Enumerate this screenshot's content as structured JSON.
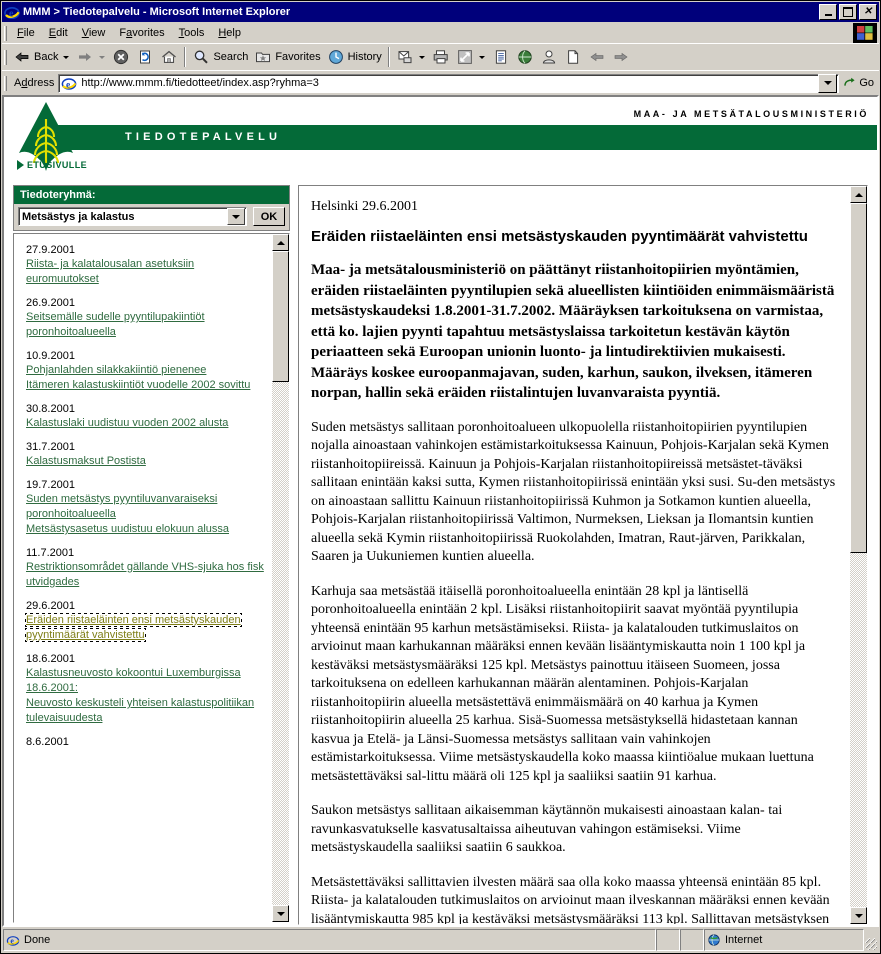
{
  "window": {
    "title": "MMM > Tiedotepalvelu - Microsoft Internet Explorer",
    "minimize_label": "Minimize",
    "maximize_label": "Maximize",
    "close_label": "Close"
  },
  "menubar": {
    "items": [
      {
        "label": "File",
        "accel": "F"
      },
      {
        "label": "Edit",
        "accel": "E"
      },
      {
        "label": "View",
        "accel": "V"
      },
      {
        "label": "Favorites",
        "accel": "a"
      },
      {
        "label": "Tools",
        "accel": "T"
      },
      {
        "label": "Help",
        "accel": "H"
      }
    ]
  },
  "toolbar": {
    "back": "Back",
    "forward": "",
    "stop": "",
    "refresh": "",
    "home": "",
    "search": "Search",
    "favorites": "Favorites",
    "history": "History",
    "mail": "",
    "print": "",
    "edit": "",
    "discuss": "",
    "messenger": "",
    "realcom": "",
    "blank": ""
  },
  "address": {
    "label": "Address",
    "value": "http://www.mmm.fi/tiedotteet/index.asp?ryhma=3",
    "go_label": "Go"
  },
  "banner": {
    "service_title": "TIEDOTEPALVELU",
    "ministry": "MAA- JA METSÄTALOUSMINISTERIÖ",
    "home_link": "ETUSIVULLE",
    "brand_green": "#046a38",
    "brand_yellow": "#e3e000"
  },
  "sidebar": {
    "group_header": "Tiedoteryhmä:",
    "select_value": "Metsästys ja kalastus",
    "ok_label": "OK",
    "news": [
      {
        "date": "27.9.2001",
        "links": [
          "Riista- ja kalatalousalan asetuksiin euromuutokset"
        ],
        "active": false
      },
      {
        "date": "26.9.2001",
        "links": [
          "Seitsemälle sudelle pyyntilupakiintiöt poronhoitoalueella"
        ],
        "active": false
      },
      {
        "date": "10.9.2001",
        "links": [
          "Pohjanlahden silakkakiintiö pienenee",
          "Itämeren kalastuskiintiöt vuodelle 2002 sovittu"
        ],
        "active": false
      },
      {
        "date": "30.8.2001",
        "links": [
          "Kalastuslaki uudistuu vuoden 2002 alusta"
        ],
        "active": false
      },
      {
        "date": "31.7.2001",
        "links": [
          "Kalastusmaksut Postista"
        ],
        "active": false
      },
      {
        "date": "19.7.2001",
        "links": [
          "Suden metsästys pyyntiluvanvaraiseksi poronhoitoalueella",
          "Metsästysasetus uudistuu elokuun alussa"
        ],
        "active": false
      },
      {
        "date": "11.7.2001",
        "links": [
          "Restriktionsområdet gällande VHS-sjuka hos fisk utvidgades"
        ],
        "active": false
      },
      {
        "date": "29.6.2001",
        "links": [
          "Eräiden riistaeläinten ensi metsästyskauden pyyntimäärät vahvistettu"
        ],
        "active": true
      },
      {
        "date": "18.6.2001",
        "links": [
          "Kalastusneuvosto kokoontui Luxemburgissa 18.6.2001:",
          "Neuvosto keskusteli yhteisen kalastuspolitiikan tulevaisuudesta"
        ],
        "active": false
      },
      {
        "date": "8.6.2001",
        "links": [],
        "active": false
      }
    ]
  },
  "article": {
    "place_date": "Helsinki 29.6.2001",
    "title": "Eräiden riistaeläinten ensi metsästyskauden pyyntimäärät vahvistettu",
    "lead": "Maa- ja metsätalousministeriö on päättänyt riistanhoitopiirien myöntämien, eräiden riistaeläinten pyyntilupien sekä alueellisten kiintiöiden enimmäismääristä metsästyskaudeksi 1.8.2001-31.7.2002. Määräyksen tarkoituksena on varmistaa, että ko. lajien pyynti tapahtuu metsästyslaissa tarkoitetun kestävän käytön periaatteen sekä Euroopan unionin luonto- ja lintudirektiivien mukaisesti. Määräys koskee euroopanmajavan, suden, karhun, saukon, ilveksen, itämeren norpan, hallin sekä eräiden riistalintujen luvanvaraista pyyntiä.",
    "paragraphs": [
      "Suden metsästys sallitaan poronhoitoalueen ulkopuolella riistanhoitopiirien pyyntilupien nojalla ainoastaan vahinkojen estämistarkoituksessa Kainuun, Pohjois-Karjalan sekä Kymen riistanhoitopiireissä. Kainuun ja Pohjois-Karjalan riistanhoitopiireissä metsästet-täväksi sallitaan enintään kaksi sutta, Kymen riistanhoitopiirissä enintään yksi susi. Su-den metsästys on ainoastaan sallittu Kainuun riistanhoitopiirissä Kuhmon ja Sotkamon kuntien alueella, Pohjois-Karjalan riistanhoitopiirissä Valtimon, Nurmeksen, Lieksan ja Ilomantsin kuntien alueella sekä Kymin riistanhoitopiirissä Ruokolahden, Imatran, Raut-järven, Parikkalan, Saaren ja Uukuniemen kuntien alueella.",
      "Karhuja saa metsästää itäisellä poronhoitoalueella enintään 28 kpl ja läntisellä poronhoitoalueella enintään 2 kpl. Lisäksi riistanhoitopiirit saavat myöntää pyyntilupia yhteensä enintään 95 karhun metsästämiseksi. Riista- ja kalatalouden tutkimuslaitos on arvioinut maan karhukannan määräksi ennen kevään lisääntymiskautta noin 1 100 kpl ja kestäväksi metsästysmääräksi 125 kpl. Metsästys painottuu itäiseen Suomeen, jossa tarkoituksena on edelleen karhukannan määrän alentaminen. Pohjois-Karjalan riistanhoitopiirin alueella metsästettävä enimmäismäärä on 40 karhua ja Kymen riistanhoitopiirin alueella 25 karhua. Sisä-Suomessa metsästyksellä hidastetaan kannan kasvua ja Etelä- ja Länsi-Suomessa metsästys sallitaan vain vahinkojen estämistarkoituksessa. Viime metsästyskaudella koko maassa kiintiöalue mukaan luettuna metsästettäväksi sal-littu määrä oli 125 kpl ja saaliiksi saatiin 91 karhua.",
      "Saukon metsästys sallitaan aikaisemman käytännön mukaisesti ainoastaan kalan- tai ravunkasvatukselle kasvatusaltaissa aiheutuvan vahingon estämiseksi. Viime metsästyskaudella saaliiksi saatiin 6 saukkoa.",
      "Metsästettäväksi sallittavien ilvesten määrä saa olla koko maassa yhteensä enintään 85 kpl. Riista- ja kalatalouden tutkimuslaitos on arvioinut maan ilveskannan määräksi ennen kevään lisääntymiskautta 985 kpl ja kestäväksi metsästysmääräksi 113 kpl. Sallittavan metsästyksen tarkoituksena on rajoittaa kannan kasvua Kymen, Pohjois-Karjalan, Pohjois-Savon sekä"
    ]
  },
  "statusbar": {
    "message": "Done",
    "zone": "Internet"
  }
}
